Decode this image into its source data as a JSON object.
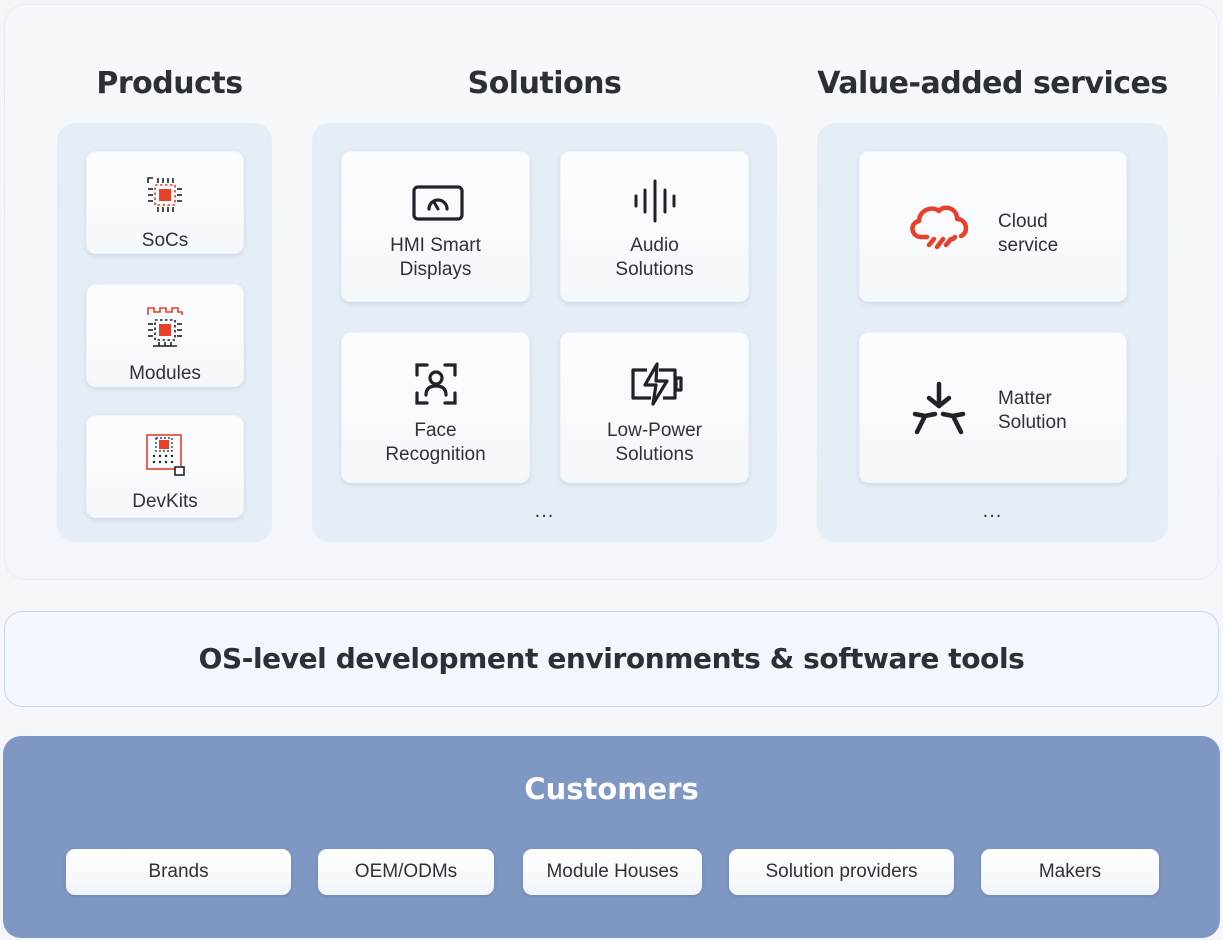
{
  "products": {
    "title": "Products",
    "items": [
      {
        "label": "SoCs",
        "icon": "soc-chip-icon"
      },
      {
        "label": "Modules",
        "icon": "module-chip-icon"
      },
      {
        "label": "DevKits",
        "icon": "devkit-board-icon"
      }
    ]
  },
  "solutions": {
    "title": "Solutions",
    "items": [
      {
        "line1": "HMI Smart",
        "line2": "Displays",
        "icon": "smart-display-icon"
      },
      {
        "line1": "Audio",
        "line2": "Solutions",
        "icon": "audio-waveform-icon"
      },
      {
        "line1": "Face",
        "line2": "Recognition",
        "icon": "face-recognition-icon"
      },
      {
        "line1": "Low-Power",
        "line2": "Solutions",
        "icon": "low-power-battery-icon"
      }
    ],
    "more": "..."
  },
  "services": {
    "title": "Value-added services",
    "items": [
      {
        "line1": "Cloud",
        "line2": "service",
        "icon": "cloud-service-icon"
      },
      {
        "line1": "Matter",
        "line2": "Solution",
        "icon": "matter-logo-icon"
      }
    ],
    "more": "..."
  },
  "os_layer": {
    "title": "OS-level development environments & software tools"
  },
  "customers": {
    "title": "Customers",
    "items": [
      "Brands",
      "OEM/ODMs",
      "Module Houses",
      "Solution providers",
      "Makers"
    ]
  },
  "colors": {
    "accent_red": "#e8402a",
    "icon_dark": "#1f2329",
    "customers_bg": "#7e98c3",
    "group_bg": "#e5edf6"
  }
}
